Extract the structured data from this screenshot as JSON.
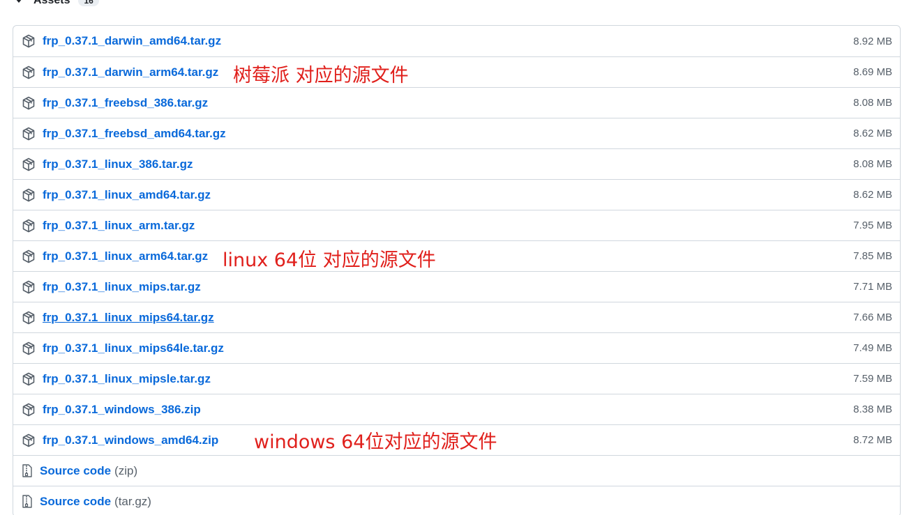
{
  "assets_header": {
    "title": "Assets",
    "count": "16"
  },
  "assets": [
    {
      "name": "frp_0.37.1_darwin_amd64.tar.gz",
      "size": "8.92 MB"
    },
    {
      "name": "frp_0.37.1_darwin_arm64.tar.gz",
      "size": "8.69 MB"
    },
    {
      "name": "frp_0.37.1_freebsd_386.tar.gz",
      "size": "8.08 MB"
    },
    {
      "name": "frp_0.37.1_freebsd_amd64.tar.gz",
      "size": "8.62 MB"
    },
    {
      "name": "frp_0.37.1_linux_386.tar.gz",
      "size": "8.08 MB"
    },
    {
      "name": "frp_0.37.1_linux_amd64.tar.gz",
      "size": "8.62 MB"
    },
    {
      "name": "frp_0.37.1_linux_arm.tar.gz",
      "size": "7.95 MB"
    },
    {
      "name": "frp_0.37.1_linux_arm64.tar.gz",
      "size": "7.85 MB"
    },
    {
      "name": "frp_0.37.1_linux_mips.tar.gz",
      "size": "7.71 MB"
    },
    {
      "name": "frp_0.37.1_linux_mips64.tar.gz",
      "size": "7.66 MB"
    },
    {
      "name": "frp_0.37.1_linux_mips64le.tar.gz",
      "size": "7.49 MB"
    },
    {
      "name": "frp_0.37.1_linux_mipsle.tar.gz",
      "size": "7.59 MB"
    },
    {
      "name": "frp_0.37.1_windows_386.zip",
      "size": "8.38 MB"
    },
    {
      "name": "frp_0.37.1_windows_amd64.zip",
      "size": "8.72 MB"
    }
  ],
  "source_code": [
    {
      "label": "Source code",
      "suffix": "(zip)"
    },
    {
      "label": "Source code",
      "suffix": "(tar.gz)"
    }
  ],
  "annotations": {
    "raspberry_pi": "树莓派 对应的源文件",
    "linux_64": "linux 64位 对应的源文件",
    "windows_64": "windows 64位对应的源文件"
  },
  "colors": {
    "link": "#0969da",
    "annotation": "#e0201c",
    "border": "#d0d7de",
    "muted": "#57606a"
  },
  "icons": {
    "asset_icon": "package-icon",
    "source_icon": "file-zip-icon"
  }
}
